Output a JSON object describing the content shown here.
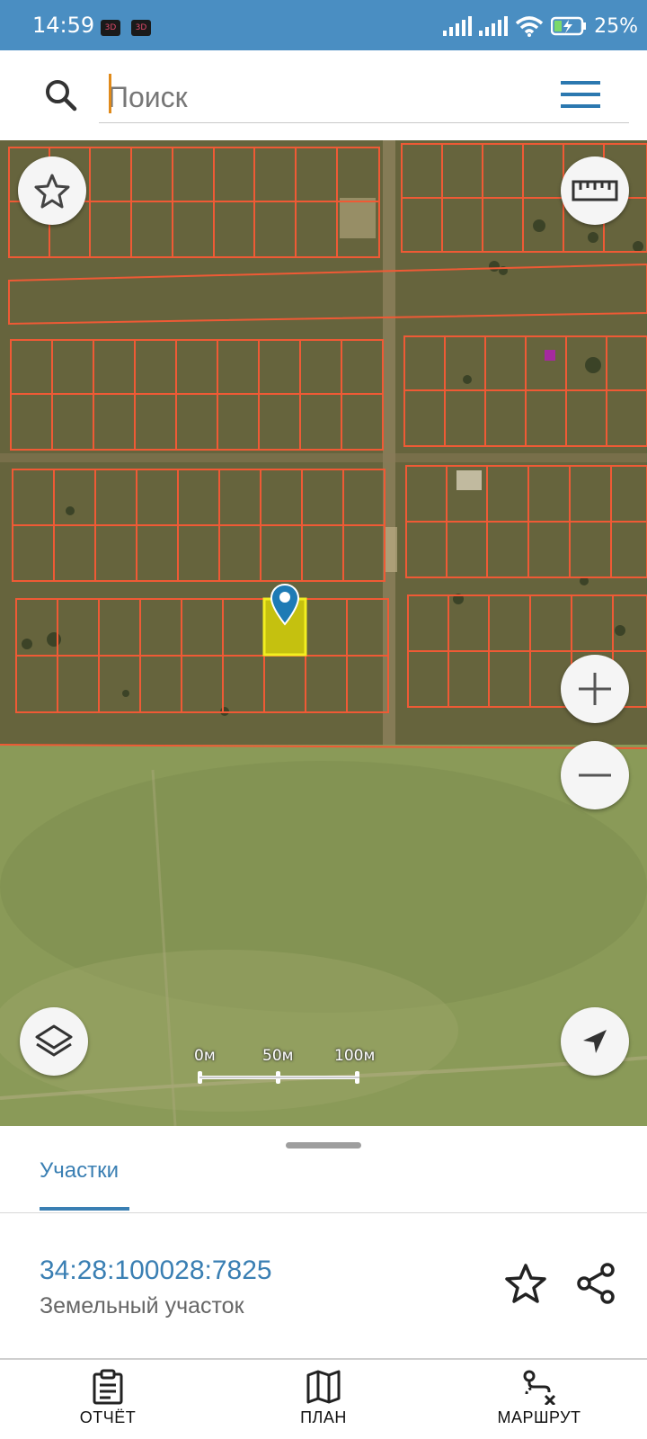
{
  "status_bar": {
    "time": "14:59",
    "notif_badge": "3D",
    "battery_percent": "25%"
  },
  "search": {
    "placeholder": "Поиск",
    "value": ""
  },
  "map": {
    "scale_labels": [
      "0м",
      "50м",
      "100м"
    ],
    "parcel_highlight_color": "#e6e000",
    "boundary_color": "#ef5a35"
  },
  "sheet": {
    "tab_label": "Участки",
    "cadastral_number": "34:28:100028:7825",
    "parcel_type": "Земельный участок"
  },
  "bottom_nav": {
    "items": [
      {
        "label": "ОТЧЁТ",
        "icon": "report-clipboard-icon"
      },
      {
        "label": "ПЛАН",
        "icon": "map-plan-icon"
      },
      {
        "label": "МАРШРУТ",
        "icon": "route-icon"
      }
    ]
  },
  "colors": {
    "accent": "#3a7fb3",
    "status_bar": "#4a8ec2"
  }
}
